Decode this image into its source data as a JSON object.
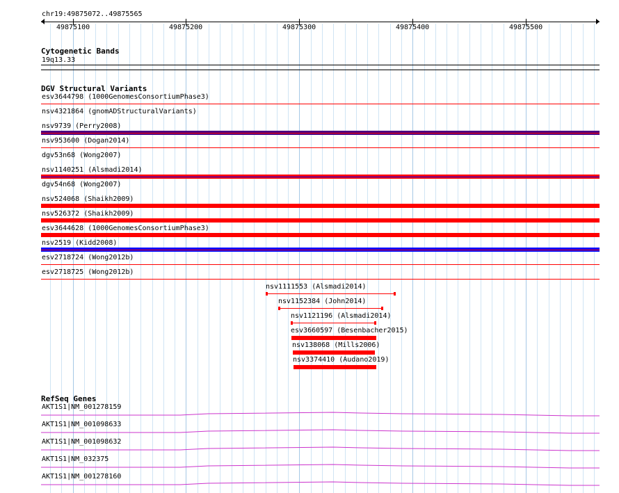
{
  "ruler": {
    "range_label": "chr19:49875072..49875565",
    "ticks": [
      "49875100",
      "49875200",
      "49875300",
      "49875400",
      "49875500"
    ]
  },
  "cytoband": {
    "title": "Cytogenetic Bands",
    "band": "19q13.33"
  },
  "dgv": {
    "title": "DGV Structural Variants",
    "rows": [
      {
        "label": "esv3644798 (1000GenomesConsortiumPhase3)",
        "color": "#ff0000",
        "bar": false
      },
      {
        "label": "nsv4321864 (gnomADStructuralVariants)",
        "color": "#4b0082",
        "bar": true
      },
      {
        "label": "nsv9739 (Perry2008)",
        "color": "#ff0000",
        "bar": false
      },
      {
        "label": "nsv953600 (Dogan2014)",
        "color": "#ff0000",
        "bar": false
      },
      {
        "label": "dgv53n68 (Wong2007)",
        "color": "#ff0000",
        "bar": true
      },
      {
        "label": "nsv1140251 (Alsmadi2014)",
        "color": "#0000ff",
        "bar": false
      },
      {
        "label": "dgv54n68 (Wong2007)",
        "color": "#ff0000",
        "bar": true
      },
      {
        "label": "nsv524068 (Shaikh2009)",
        "color": "#ff0000",
        "bar": true
      },
      {
        "label": "nsv526372 (Shaikh2009)",
        "color": "#ff0000",
        "bar": true
      },
      {
        "label": "esv3644628 (1000GenomesConsortiumPhase3)",
        "color": "#0000ff",
        "bar": true
      },
      {
        "label": "nsv2519 (Kidd2008)",
        "color": "#ff0000",
        "bar": false
      },
      {
        "label": "esv2718724 (Wong2012b)",
        "color": "#ff0000",
        "bar": false
      },
      {
        "label": "esv2718725 (Wong2012b)",
        "color": "#ff0000",
        "bar": false
      }
    ],
    "stacked": [
      {
        "label": "nsv1111553 (Alsmadi2014)",
        "start": 49875271,
        "end": 49875384,
        "style": "whisker"
      },
      {
        "label": "nsv1152384 (John2014)",
        "start": 49875282,
        "end": 49875373,
        "style": "whisker"
      },
      {
        "label": "nsv1121196 (Alsmadi2014)",
        "start": 49875293,
        "end": 49875367,
        "style": "whisker"
      },
      {
        "label": "esv3660597 (Besenbacher2015)",
        "start": 49875293,
        "end": 49875368,
        "style": "bar"
      },
      {
        "label": "nsv138068 (Mills2006)",
        "start": 49875294,
        "end": 49875367,
        "style": "bar"
      },
      {
        "label": "nsv3374410 (Audano2019)",
        "start": 49875295,
        "end": 49875368,
        "style": "bar"
      }
    ]
  },
  "refseq": {
    "title": "RefSeq Genes",
    "color": "#cc33cc",
    "rows": [
      {
        "label": "AKT1S1|NM_001278159"
      },
      {
        "label": "AKT1S1|NM_001098633"
      },
      {
        "label": "AKT1S1|NM_001098632"
      },
      {
        "label": "AKT1S1|NM_032375"
      },
      {
        "label": "AKT1S1|NM_001278160"
      }
    ]
  }
}
